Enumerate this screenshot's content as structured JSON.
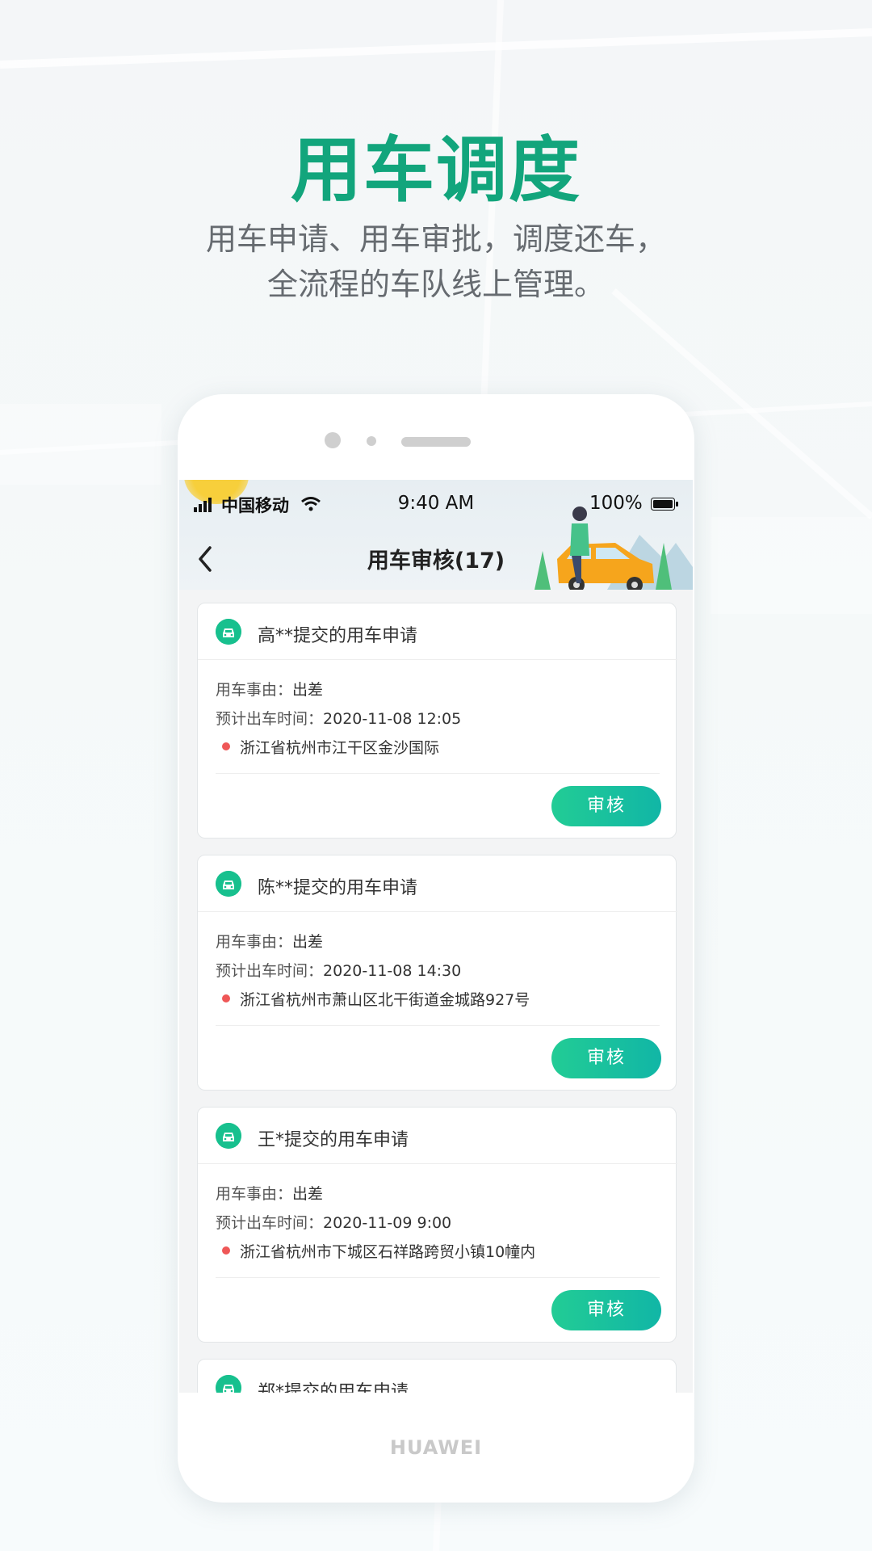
{
  "hero": {
    "title": "用车调度",
    "subtitle_line1": "用车申请、用车审批，调度还车，",
    "subtitle_line2": "全流程的车队线上管理。"
  },
  "status_bar": {
    "carrier": "中国移动",
    "time": "9:40 AM",
    "battery": "100%"
  },
  "nav": {
    "title": "用车审核(17)"
  },
  "labels": {
    "reason": "用车事由：",
    "time": "预计出车时间：",
    "approve": "审核"
  },
  "requests": [
    {
      "title": "高**提交的用车申请",
      "reason": "出差",
      "time": "2020-11-08 12:05",
      "address": "浙江省杭州市江干区金沙国际"
    },
    {
      "title": "陈**提交的用车申请",
      "reason": "出差",
      "time": "2020-11-08 14:30",
      "address": "浙江省杭州市萧山区北干街道金城路927号"
    },
    {
      "title": "王*提交的用车申请",
      "reason": "出差",
      "time": "2020-11-09 9:00",
      "address": "浙江省杭州市下城区石祥路跨贸小镇10幢内"
    },
    {
      "title": "郑*提交的用车申请"
    }
  ],
  "device_brand": "HUAWEI",
  "colors": {
    "accent": "#12a57c",
    "button": "#1bc29b",
    "dot": "#ef5757"
  }
}
